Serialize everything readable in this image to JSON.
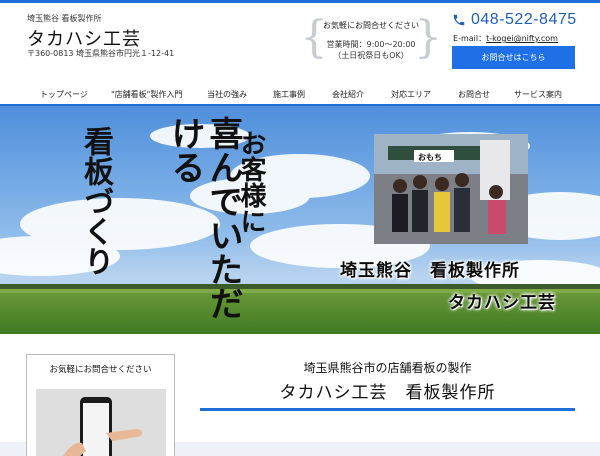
{
  "header": {
    "tagline": "埼玉熊谷 看板製作所",
    "site_name": "タカハシ工芸",
    "address": "〒360-0813 埼玉県熊谷市円光１-12-41"
  },
  "contact_box": {
    "title": "お気軽にお問合せください",
    "hours_line1": "営業時間：9:00〜20:00",
    "hours_line2": "（土日祝祭日もOK）"
  },
  "phone": {
    "number": "048-522-8475",
    "icon": "phone-icon"
  },
  "email": {
    "label": "E-mail：",
    "address": "t-kogei@nifty.com"
  },
  "inquiry_button": "お問合せはこちら",
  "nav": [
    "トップページ",
    "\"店舗看板\"製作入門",
    "当社の強み",
    "施工事例",
    "会社紹介",
    "対応エリア",
    "お問合せ",
    "サービス案内"
  ],
  "hero": {
    "brush_text_1": "お客様に",
    "brush_text_2": "喜んでいただける",
    "brush_text_3": "看板づくり",
    "caption_1": "埼玉熊谷　看板製作所",
    "caption_2": "タカハシ工芸",
    "photo_sign": "おもち"
  },
  "sidebar": {
    "title": "お気軽にお問合せください"
  },
  "main": {
    "subtitle": "埼玉県熊谷市の店舗看板の製作",
    "title": "タカハシ工芸　看板製作所"
  },
  "colors": {
    "accent": "#1f6fd8",
    "button": "#1f6fe6",
    "phone": "#1f5fbd"
  }
}
